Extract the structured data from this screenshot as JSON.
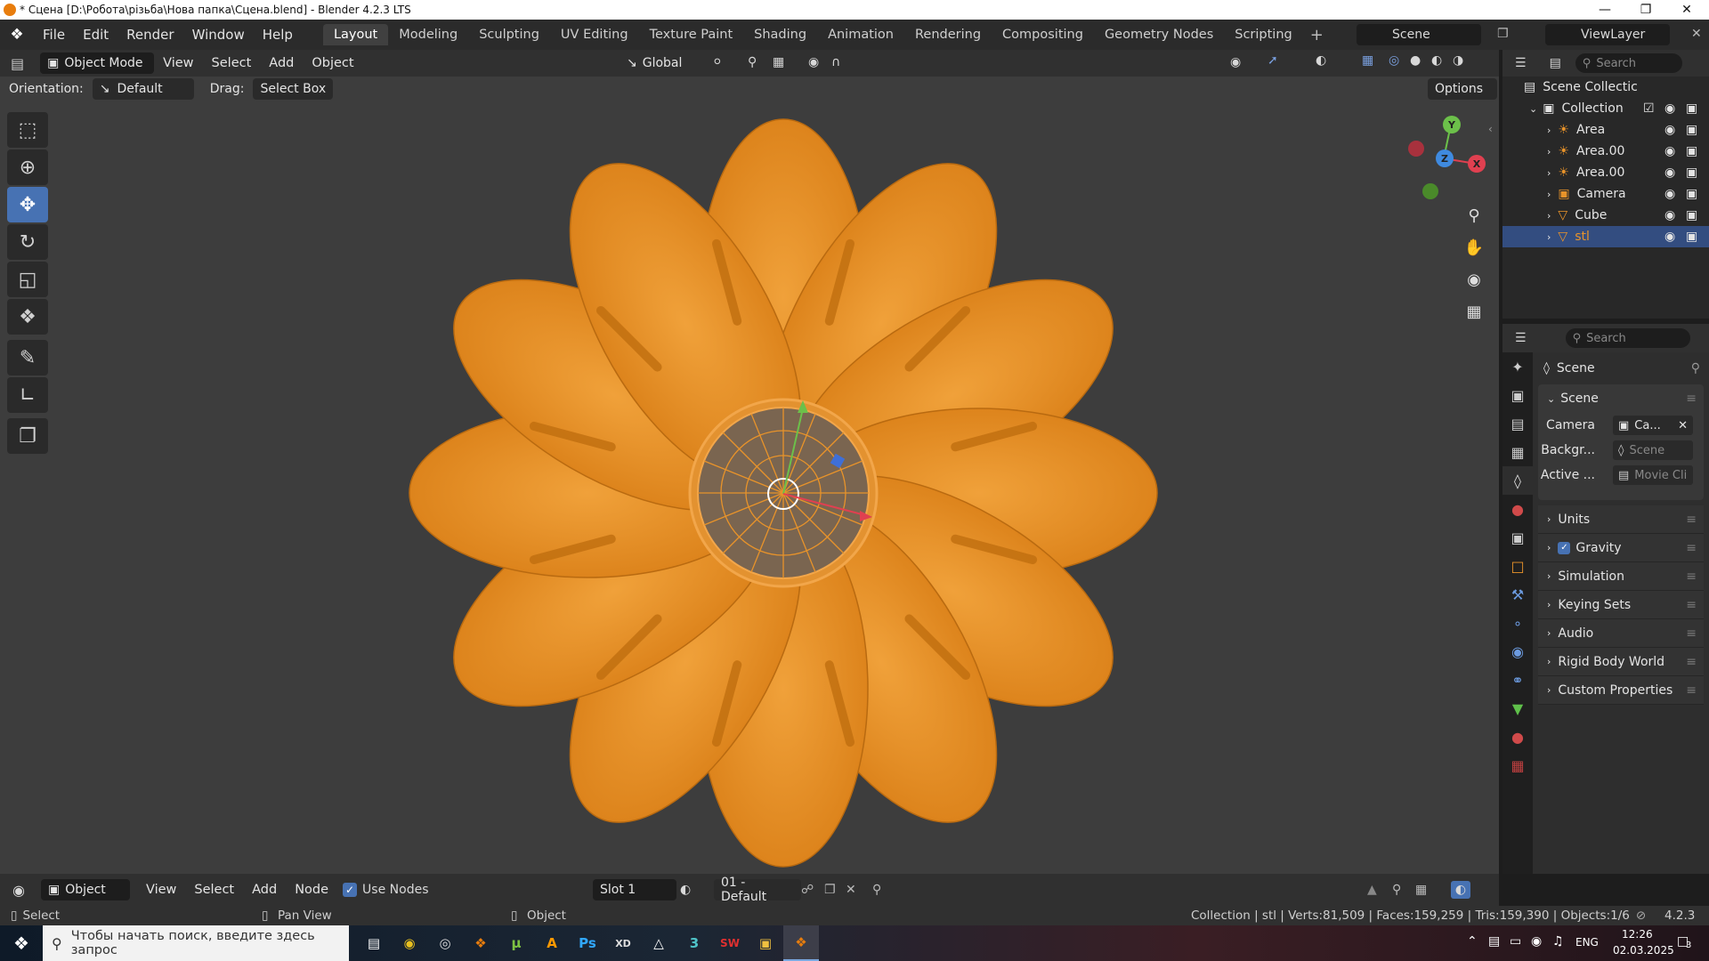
{
  "titlebar": {
    "title": "* Сцена [D:\\Робота\\різьба\\Нова папка\\Сцена.blend] - Blender 4.2.3 LTS"
  },
  "menu": {
    "file": "File",
    "edit": "Edit",
    "render": "Render",
    "window": "Window",
    "help": "Help"
  },
  "workspaces": [
    "Layout",
    "Modeling",
    "Sculpting",
    "UV Editing",
    "Texture Paint",
    "Shading",
    "Animation",
    "Rendering",
    "Compositing",
    "Geometry Nodes",
    "Scripting"
  ],
  "scene_selector": {
    "scene": "Scene",
    "view_layer": "ViewLayer"
  },
  "viewport_header": {
    "mode": "Object Mode",
    "view": "View",
    "select": "Select",
    "add": "Add",
    "object": "Object",
    "transform": "Global"
  },
  "tool_options": {
    "orientation_label": "Orientation:",
    "orientation_value": "Default",
    "drag_label": "Drag:",
    "drag_value": "Select Box",
    "options": "Options"
  },
  "gizmo": {
    "x": "X",
    "y": "Y",
    "z": "Z"
  },
  "outliner": {
    "search_placeholder": "Search",
    "root": "Scene Collectic",
    "collection": "Collection",
    "items": [
      {
        "name": "Area",
        "icon": "light-icon"
      },
      {
        "name": "Area.00",
        "icon": "light-icon"
      },
      {
        "name": "Area.00",
        "icon": "light-icon"
      },
      {
        "name": "Camera",
        "icon": "camera-icon"
      },
      {
        "name": "Cube",
        "icon": "mesh-icon"
      },
      {
        "name": "stl",
        "icon": "mesh-icon",
        "selected": true
      }
    ]
  },
  "properties": {
    "search_placeholder": "Search",
    "context": "Scene",
    "panel_title": "Scene",
    "camera_label": "Camera",
    "camera_value": "Ca...",
    "background_label": "Backgr...",
    "background_value": "Scene",
    "active_clip_label": "Active ...",
    "active_clip_value": "Movie Cli",
    "panels": [
      "Units",
      "Gravity",
      "Simulation",
      "Keying Sets",
      "Audio",
      "Rigid Body World",
      "Custom Properties"
    ],
    "gravity_checked": true
  },
  "shader_header": {
    "type": "Object",
    "view": "View",
    "select": "Select",
    "add": "Add",
    "node": "Node",
    "use_nodes": "Use Nodes",
    "slot": "Slot 1",
    "material": "01 - Default"
  },
  "statusbar": {
    "select": "Select",
    "pan_view": "Pan View",
    "object": "Object",
    "stats": "Collection | stl | Verts:81,509 | Faces:159,259 | Tris:159,390 | Objects:1/6",
    "version": "4.2.3"
  },
  "taskbar": {
    "search_placeholder": "Чтобы начать поиск, введите здесь запрос",
    "lang": "ENG",
    "time": "12:26",
    "date": "02.03.2025",
    "notifications": "3",
    "apps": [
      "task-view-icon",
      "chrome-icon",
      "app-icon",
      "blender-icon",
      "utorrent-icon",
      "illustrator-icon",
      "photoshop-icon",
      "xdpen-icon",
      "inkscape-icon",
      "app3-icon",
      "solidworks-icon",
      "explorer-icon",
      "blender-active-icon"
    ]
  },
  "colors": {
    "accent": "#4772b3",
    "mesh": "#e8932a",
    "viewport": "#3d3d3d",
    "selected_row": "#334d80"
  }
}
